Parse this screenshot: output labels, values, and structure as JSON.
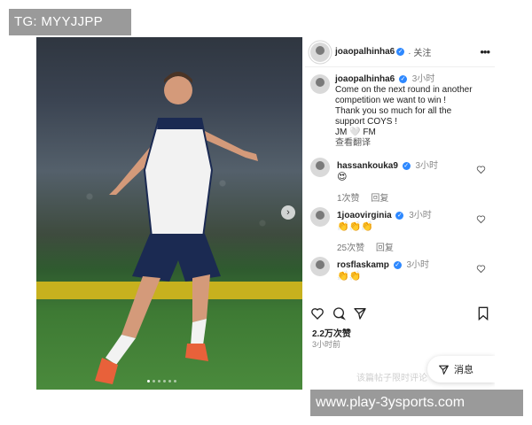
{
  "watermark_top": "TG: MYYJJPP",
  "watermark_bottom": "www.play-3ysports.com",
  "post": {
    "photo_alt": "Player celebrating on the pitch",
    "header": {
      "username": "joaopalhinha6",
      "follow_label": "关注",
      "more_icon": "more-icon"
    },
    "caption": {
      "username": "joaopalhinha6",
      "time": "3小时",
      "lines": [
        "Come on the next round in another",
        "competition we want to win !",
        "Thank you so much for all the",
        "support COYS !",
        "JM 🤍 FM"
      ],
      "translate_label": "查看翻译"
    },
    "comments": [
      {
        "username": "hassankouka9",
        "time": "3小时",
        "text": "😍",
        "likes": "1次赞",
        "reply": "回复"
      },
      {
        "username": "1joaovirginia",
        "time": "3小时",
        "text": "👏👏👏",
        "likes": "25次赞",
        "reply": "回复"
      },
      {
        "username": "rosflaskamp",
        "time": "3小时",
        "text": "👏👏",
        "likes": "",
        "reply": ""
      }
    ],
    "likes_count": "2.2万次赞",
    "posted_ago": "3小时前",
    "faded_text": "该篇帖子限时评论",
    "message_button": "消息",
    "colors": {
      "verified": "#2d88ff",
      "pitch": "#4a8a3c",
      "sponsor": "#c7b11e"
    }
  }
}
